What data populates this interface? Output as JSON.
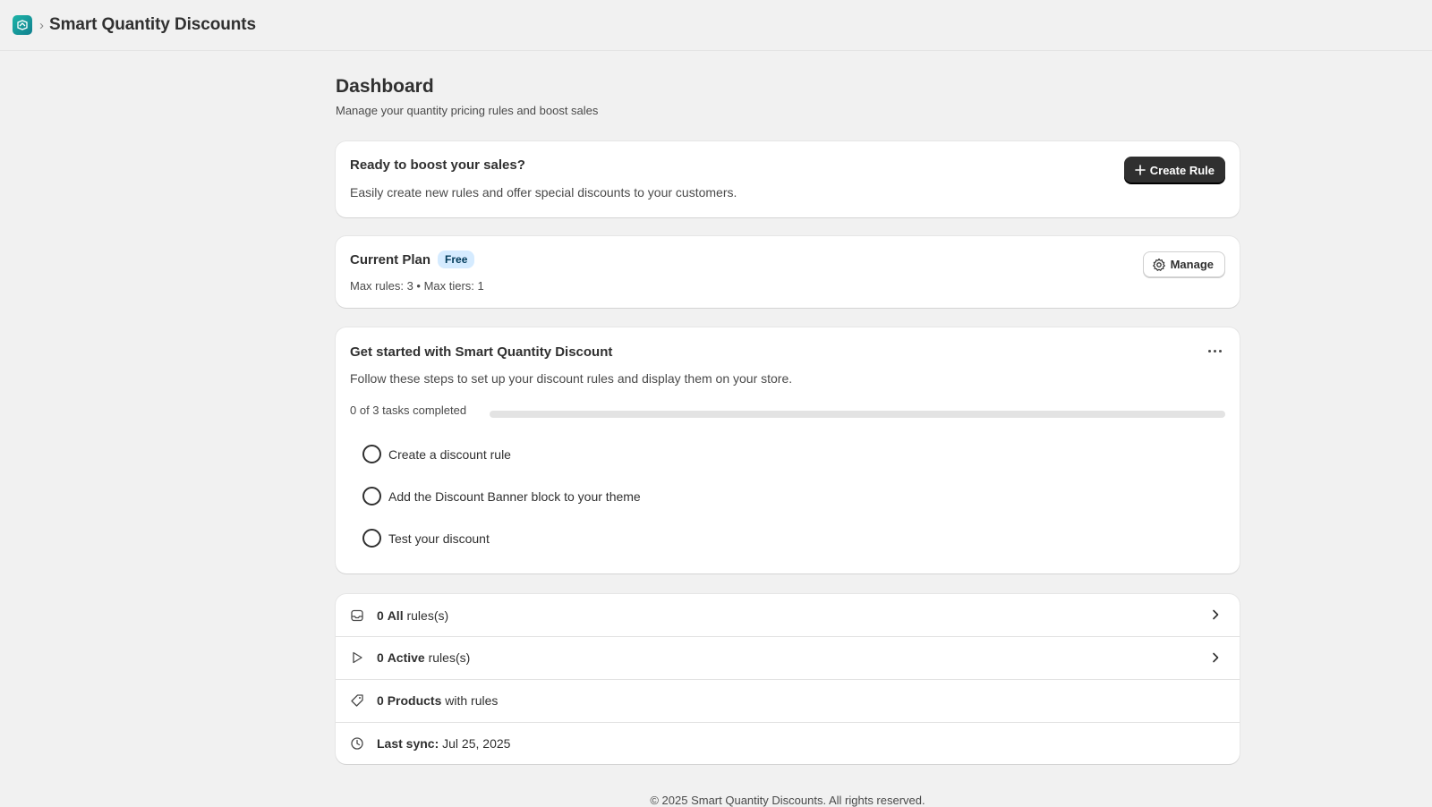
{
  "topbar": {
    "app_title": "Smart Quantity Discounts",
    "separator": "›"
  },
  "page": {
    "title": "Dashboard",
    "subtitle": "Manage your quantity pricing rules and boost sales"
  },
  "promo_card": {
    "title": "Ready to boost your sales?",
    "text": "Easily create new rules and offer special discounts to your customers.",
    "button_label": "Create Rule"
  },
  "plan_card": {
    "title": "Current Plan",
    "badge": "Free",
    "limits": "Max rules: 3 • Max tiers: 1",
    "button_label": "Manage"
  },
  "setup_card": {
    "title": "Get started with Smart Quantity Discount",
    "text": "Follow these steps to set up your discount rules and display them on your store.",
    "progress_label": "0 of 3 tasks completed",
    "progress_fraction": 0,
    "tasks": [
      {
        "label": "Create a discount rule",
        "done": false
      },
      {
        "label": "Add the Discount Banner block to your theme",
        "done": false
      },
      {
        "label": "Test your discount",
        "done": false
      }
    ]
  },
  "stats": {
    "all_rules": {
      "count": "0",
      "strong": "All",
      "suffix": "rules(s)"
    },
    "active_rules": {
      "count": "0",
      "strong": "Active",
      "suffix": "rules(s)"
    },
    "products": {
      "count": "0",
      "strong": "Products",
      "suffix": "with rules"
    },
    "last_sync": {
      "strong": "Last sync:",
      "value": "Jul 25, 2025"
    }
  },
  "footer": {
    "text": "© 2025 Smart Quantity Discounts. All rights reserved."
  },
  "colors": {
    "background": "#f1f1f1",
    "primary_button": "#303030",
    "badge_bg": "#d5ebff",
    "app_logo": "#1fb5a8"
  },
  "icons": [
    "app-logo-icon",
    "plus-icon",
    "gear-icon",
    "more-dots-icon",
    "inbox-icon",
    "play-icon",
    "tag-icon",
    "clock-icon",
    "chevron-right-icon"
  ]
}
